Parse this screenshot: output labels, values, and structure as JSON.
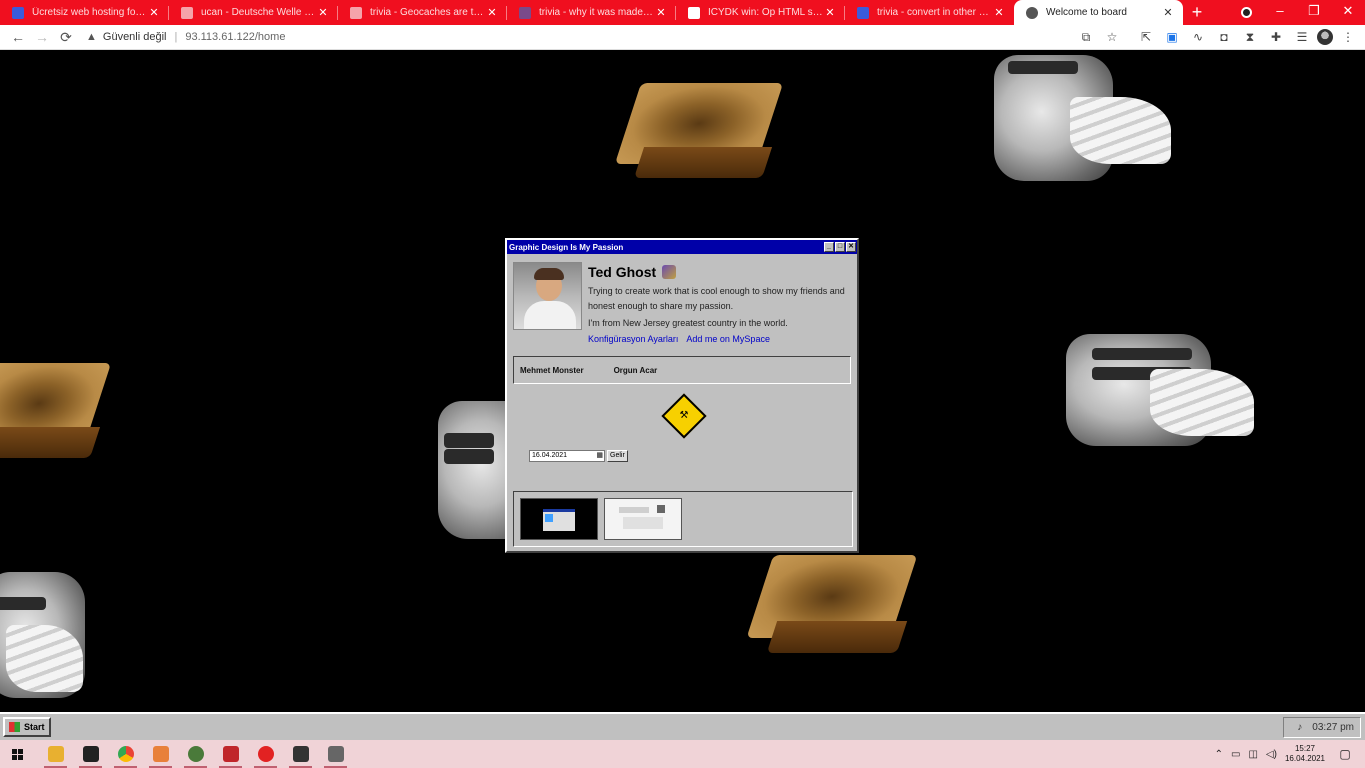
{
  "browser": {
    "tabs": [
      {
        "title": "Ücretsiz web hosting for displays",
        "favicon_color": "#3b5bdb",
        "active": false
      },
      {
        "title": "ucan - Deutsche Welle in Tier ...",
        "favicon_color": "#f5a3aa",
        "active": false
      },
      {
        "title": "trivia - Geocaches are the best",
        "favicon_color": "#f5a3aa",
        "active": false
      },
      {
        "title": "trivia - why it was made with ...",
        "favicon_color": "#7a4a8a",
        "active": false
      },
      {
        "title": "ICYDK win: Op HTML scripts",
        "favicon_color": "#ffffff",
        "active": false
      },
      {
        "title": "trivia - convert in other people ...",
        "favicon_color": "#3b5bdb",
        "active": false
      },
      {
        "title": "Welcome to board",
        "favicon_color": "#555555",
        "active": true
      }
    ],
    "new_tab": "+",
    "window_buttons": [
      "–",
      "❐",
      "✕"
    ],
    "nav": {
      "back": "←",
      "forward": "→",
      "reload": "⟳"
    },
    "omnibox": {
      "security": "Güvenli değil",
      "url": "93.113.61.122/home"
    },
    "toolbar_icons": [
      "translate-icon",
      "star-icon",
      "extension-icon",
      "extension-icon",
      "extension-icon",
      "extension-icon",
      "puzzle-icon",
      "reading-list-icon",
      "avatar",
      "menu-icon"
    ]
  },
  "window": {
    "title": "Graphic Design Is My Passion",
    "controls": [
      "_",
      "□",
      "✕"
    ],
    "profile": {
      "name": "Ted Ghost",
      "bio": "Trying to create work that is cool enough to show my friends and honest enough to share my passion.",
      "location": "I'm from New Jersey greatest country in the world.",
      "links": [
        "Konfigürasyon Ayarları",
        "Add me on MySpace"
      ]
    },
    "friends": [
      "Mehmet Monster",
      "Orgun Acar"
    ],
    "date_value": "16.04.2021",
    "date_button": "Gelir"
  },
  "retro_taskbar": {
    "start_label": "Start",
    "clock": "03:27 pm"
  },
  "os_taskbar": {
    "apps": [
      {
        "name": "file-explorer-icon",
        "color": "#e8b030",
        "running": true
      },
      {
        "name": "terminal-icon",
        "color": "#222222",
        "running": true
      },
      {
        "name": "chrome-icon",
        "color": "#34a853",
        "running": true
      },
      {
        "name": "sublime-icon",
        "color": "#e8803a",
        "running": true
      },
      {
        "name": "app-icon",
        "color": "#4a7a3a",
        "running": true
      },
      {
        "name": "filezilla-icon",
        "color": "#c0262a",
        "running": true
      },
      {
        "name": "media-icon",
        "color": "#e22222",
        "running": true
      },
      {
        "name": "terminal-icon",
        "color": "#333333",
        "running": true
      },
      {
        "name": "window-icon",
        "color": "#666666",
        "running": true
      }
    ],
    "time": "15:27",
    "date": "16.04.2021"
  }
}
